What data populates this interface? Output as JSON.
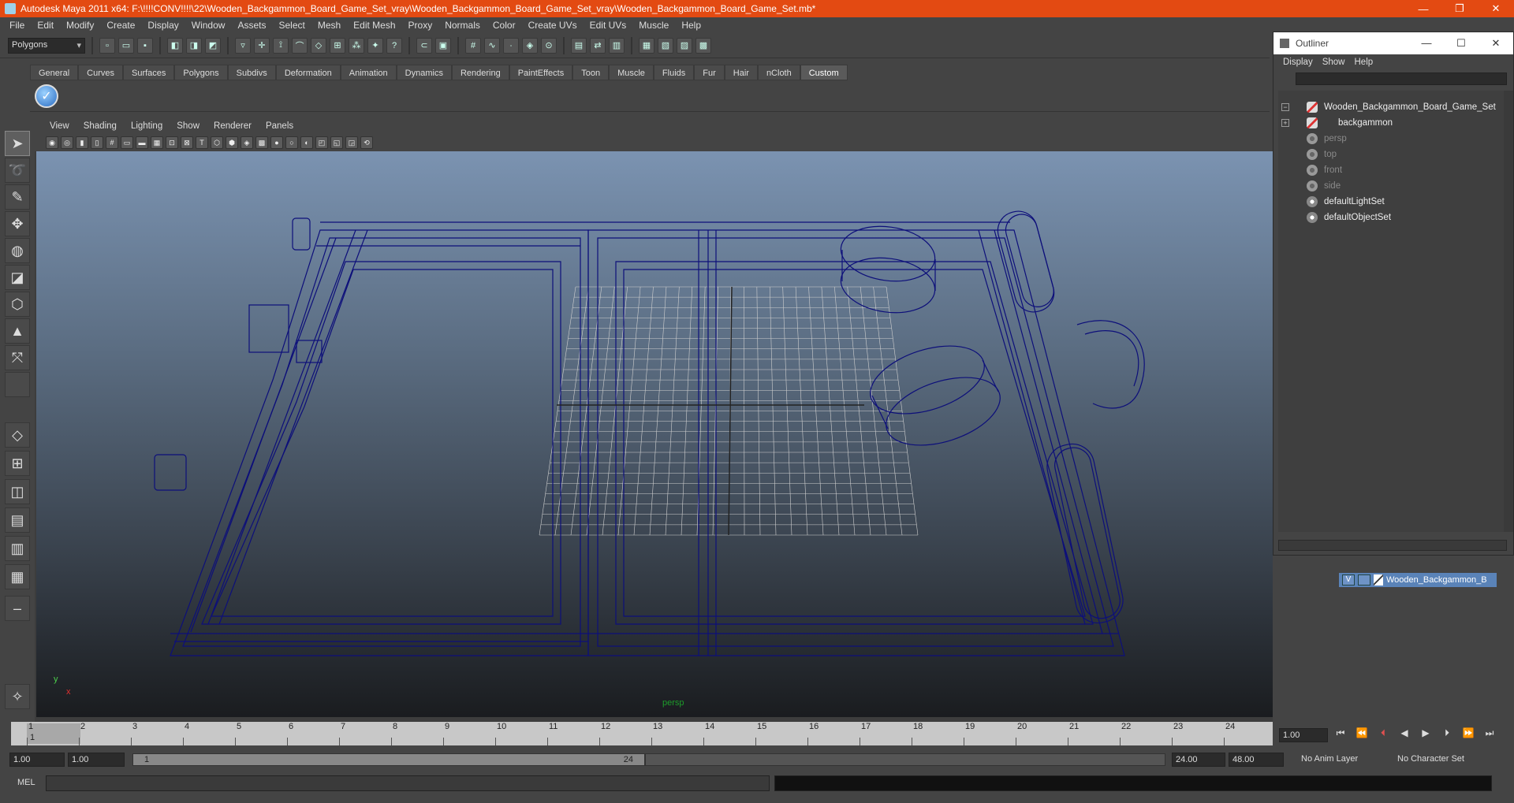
{
  "app": {
    "title": "Autodesk Maya 2011 x64: F:\\!!!!CONV!!!!\\22\\Wooden_Backgammon_Board_Game_Set_vray\\Wooden_Backgammon_Board_Game_Set_vray\\Wooden_Backgammon_Board_Game_Set.mb*",
    "accent_color": "#e34a12"
  },
  "window_buttons": [
    "—",
    "❐",
    "✕"
  ],
  "menubar": [
    "File",
    "Edit",
    "Modify",
    "Create",
    "Display",
    "Window",
    "Assets",
    "Select",
    "Mesh",
    "Edit Mesh",
    "Proxy",
    "Normals",
    "Color",
    "Create UVs",
    "Edit UVs",
    "Muscle",
    "Help"
  ],
  "status": {
    "mode": "Polygons"
  },
  "shelf": {
    "tabs": [
      "General",
      "Curves",
      "Surfaces",
      "Polygons",
      "Subdivs",
      "Deformation",
      "Animation",
      "Dynamics",
      "Rendering",
      "PaintEffects",
      "Toon",
      "Muscle",
      "Fluids",
      "Fur",
      "Hair",
      "nCloth",
      "Custom"
    ],
    "active_tab": "Custom"
  },
  "viewport": {
    "menu": [
      "View",
      "Shading",
      "Lighting",
      "Show",
      "Renderer",
      "Panels"
    ],
    "camera_label": "persp",
    "axis_y": "y",
    "axis_x": "x",
    "wireframe_color": "#0d0f7a",
    "grid_color": "#cfcfcf"
  },
  "outliner": {
    "title": "Outliner",
    "menu": [
      "Display",
      "Show",
      "Help"
    ],
    "items": [
      {
        "label": "Wooden_Backgammon_Board_Game_Set",
        "icon": "transform-icon",
        "dim": false,
        "expand": "−"
      },
      {
        "label": "backgammon",
        "icon": "transform-icon",
        "dim": false,
        "expand": "+"
      },
      {
        "label": "persp",
        "icon": "camera-icon",
        "dim": true,
        "expand": ""
      },
      {
        "label": "top",
        "icon": "camera-icon",
        "dim": true,
        "expand": ""
      },
      {
        "label": "front",
        "icon": "camera-icon",
        "dim": true,
        "expand": ""
      },
      {
        "label": "side",
        "icon": "camera-icon",
        "dim": true,
        "expand": ""
      },
      {
        "label": "defaultLightSet",
        "icon": "set-icon",
        "dim": false,
        "expand": ""
      },
      {
        "label": "defaultObjectSet",
        "icon": "set-icon",
        "dim": false,
        "expand": ""
      }
    ]
  },
  "layers": {
    "visible_flag": "V",
    "layer_name": "Wooden_Backgammon_B"
  },
  "timeline": {
    "ticks": [
      "1",
      "2",
      "3",
      "4",
      "5",
      "6",
      "7",
      "8",
      "9",
      "10",
      "11",
      "12",
      "13",
      "14",
      "15",
      "16",
      "17",
      "18",
      "19",
      "20",
      "21",
      "22",
      "23",
      "24"
    ],
    "current_frame_mark": "1",
    "current_frame": "1.00"
  },
  "range": {
    "start_time": "1.00",
    "playback_start": "1.00",
    "slider_start": "1",
    "slider_end": "24",
    "playback_end": "24.00",
    "end_time": "48.00",
    "anim_layer": "No Anim Layer",
    "character_set": "No Character Set"
  },
  "cmdline": {
    "label": "MEL"
  }
}
